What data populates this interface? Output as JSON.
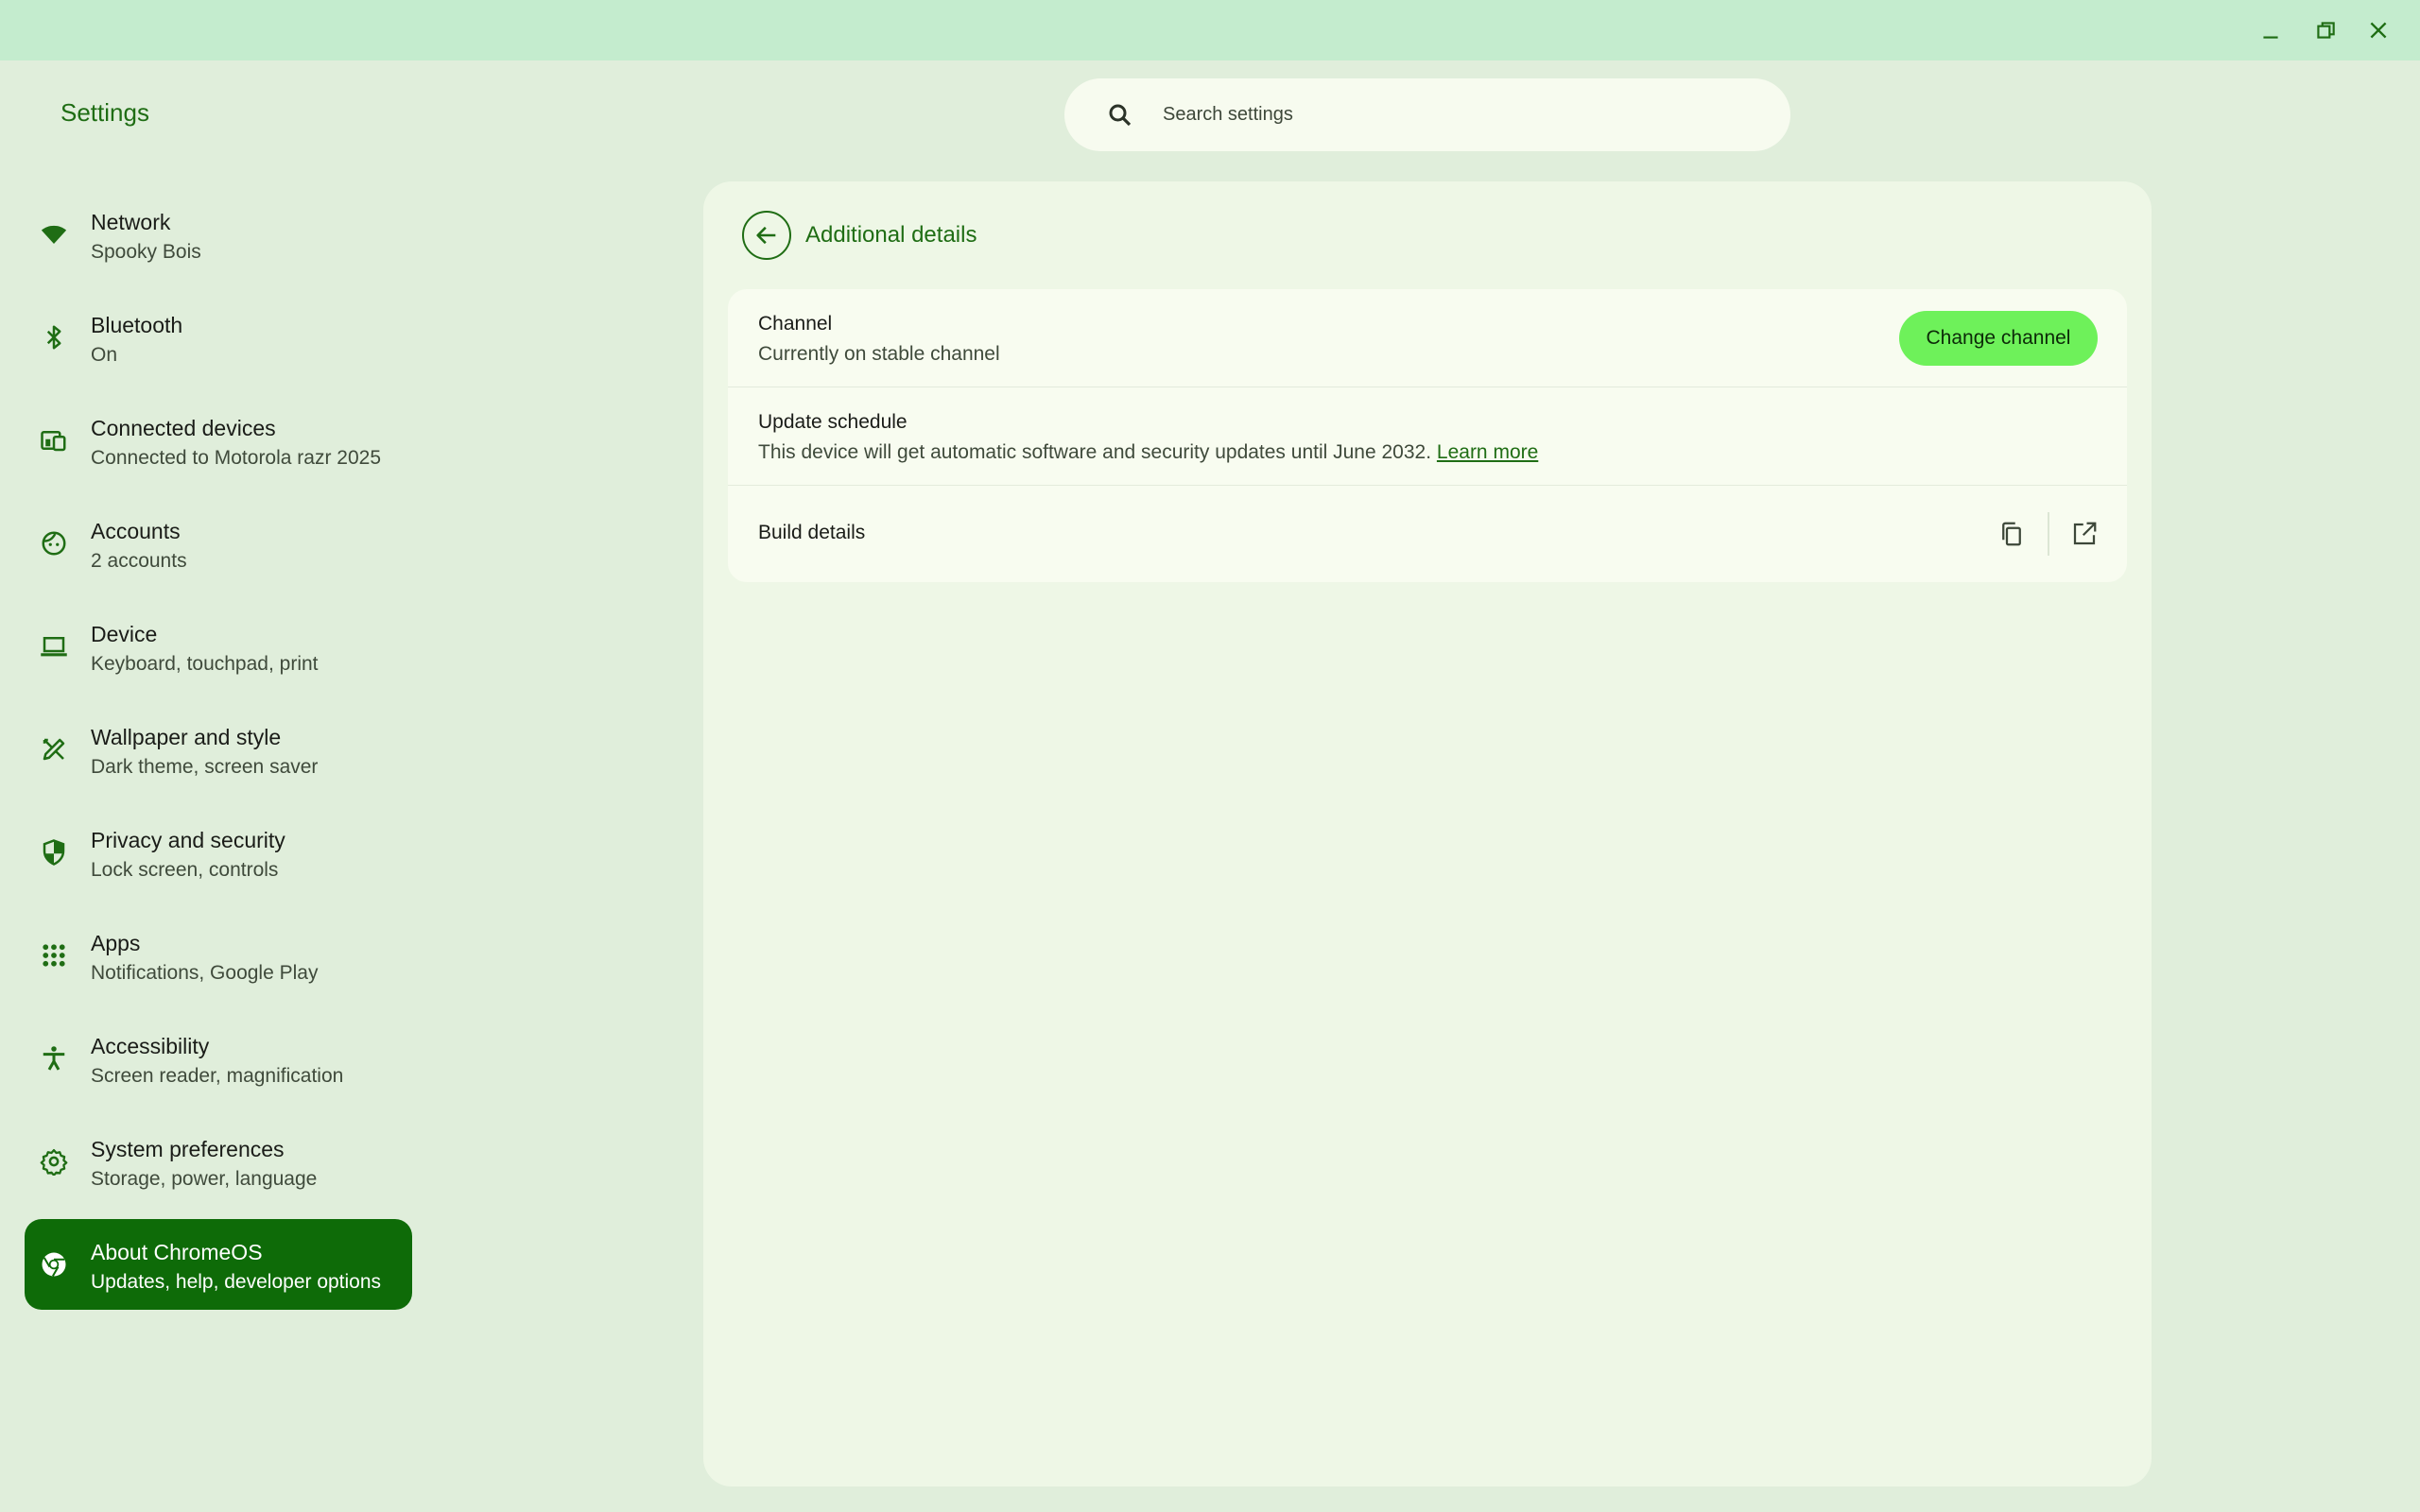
{
  "window": {
    "minimize_icon": "minimize-icon",
    "restore_icon": "restore-icon",
    "close_icon": "close-icon"
  },
  "app": {
    "title": "Settings"
  },
  "search": {
    "placeholder": "Search settings",
    "icon": "search-icon"
  },
  "sidebar": {
    "items": [
      {
        "label": "Network",
        "sub": "Spooky Bois",
        "icon": "wifi-icon"
      },
      {
        "label": "Bluetooth",
        "sub": "On",
        "icon": "bluetooth-icon"
      },
      {
        "label": "Connected devices",
        "sub": "Connected to Motorola razr 2025",
        "icon": "devices-icon"
      },
      {
        "label": "Accounts",
        "sub": "2 accounts",
        "icon": "face-icon"
      },
      {
        "label": "Device",
        "sub": "Keyboard, touchpad, print",
        "icon": "laptop-icon"
      },
      {
        "label": "Wallpaper and style",
        "sub": "Dark theme, screen saver",
        "icon": "palette-icon"
      },
      {
        "label": "Privacy and security",
        "sub": "Lock screen, controls",
        "icon": "shield-icon"
      },
      {
        "label": "Apps",
        "sub": "Notifications, Google Play",
        "icon": "apps-grid-icon"
      },
      {
        "label": "Accessibility",
        "sub": "Screen reader, magnification",
        "icon": "accessibility-icon"
      },
      {
        "label": "System preferences",
        "sub": "Storage, power, language",
        "icon": "gear-icon"
      },
      {
        "label": "About ChromeOS",
        "sub": "Updates, help, developer options",
        "icon": "chrome-icon",
        "active": true
      }
    ]
  },
  "panel": {
    "title": "Additional details",
    "back_icon": "back-arrow-icon",
    "channel": {
      "label": "Channel",
      "sub": "Currently on stable channel",
      "button": "Change channel"
    },
    "update_schedule": {
      "label": "Update schedule",
      "sub": "This device will get automatic software and security updates until June 2032.",
      "link": "Learn more"
    },
    "build_details": {
      "label": "Build details",
      "copy_icon": "copy-icon",
      "open_icon": "open-external-icon"
    }
  },
  "colors": {
    "accent": "#1f6d14",
    "active_bg": "#0e6b08",
    "button_bg": "#6ef15a",
    "titlebar_bg": "#c4ecce",
    "window_bg": "#e0eedb"
  }
}
